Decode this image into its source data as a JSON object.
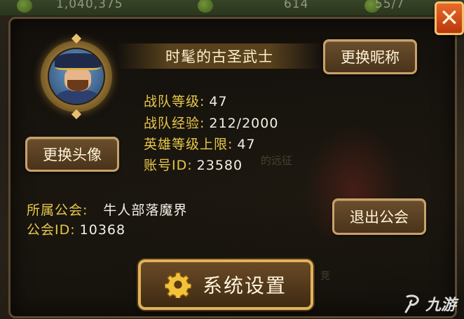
{
  "topbar": {
    "gold": "1,040,375",
    "gems": "614",
    "stamina": "55/7"
  },
  "profile": {
    "name": "时髦的古圣武士",
    "rename_label": "更换昵称",
    "change_avatar_label": "更换头像",
    "stats": [
      {
        "label": "战队等级:",
        "value": "47"
      },
      {
        "label": "战队经验:",
        "value": "212/2000"
      },
      {
        "label": "英雄等级上限:",
        "value": "47"
      },
      {
        "label": "账号ID:",
        "value": "23580"
      }
    ]
  },
  "guild": {
    "name_label": "所属公会:",
    "name_value": "牛人部落魔界",
    "id_label": "公会ID:",
    "id_value": "10368",
    "leave_label": "退出公会"
  },
  "settings_label": "系统设置",
  "close_label": "✕",
  "background_text": {
    "bg1": "的远征",
    "bg2": "竞"
  },
  "watermark": {
    "text": "九游"
  },
  "colors": {
    "stat_label": "#e8c84a",
    "close_bg": "#d9561c",
    "button_border": "#c8a26a"
  }
}
